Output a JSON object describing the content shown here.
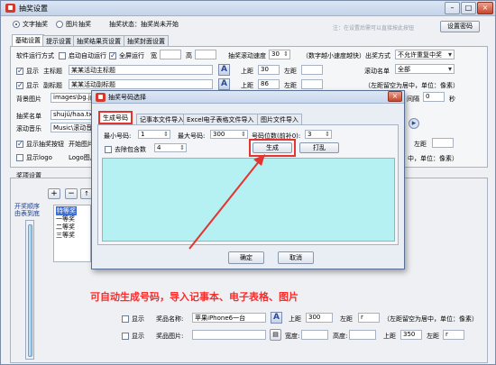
{
  "window": {
    "title": "抽奖设置",
    "minimize": "–",
    "maximize": "□",
    "close": "×"
  },
  "topbar": {
    "mode_text": "文字抽奖",
    "mode_image": "图片抽奖",
    "status": "抽奖状态：抽奖尚未开始",
    "note": "注：在设置后需可以直接按此按钮",
    "settings_pwd_button": "设置密码"
  },
  "tabs": [
    "基础设置",
    "提示设置",
    "抽奖结果页设置",
    "抽奖封面设置"
  ],
  "basic": {
    "run_mode_label": "软件运行方式",
    "auto_run": "启动自动运行",
    "fullscreen": "全屏运行",
    "width_label": "宽",
    "height_label": "高",
    "speed_label": "抽奖滚动速度",
    "speed_value": "30",
    "speed_note": "（数字越小速度越快）",
    "exit_mode_label": "出奖方式",
    "exit_mode_value": "不允许重复中奖",
    "show1": "显示",
    "main_title_label": "主标题",
    "main_title_value": "某某活动主标题",
    "show2": "显示",
    "sub_title_label": "副标题",
    "sub_title_value": "某某活动副标题",
    "top_label": "上距",
    "left_label": "左距",
    "main_top": "30",
    "sub_top": "86",
    "roll_list_label": "滚动名单",
    "roll_list_value": "全部",
    "center_note": "（左距留空为居中，单位：像素）",
    "bg_label": "背景图片",
    "bg_value": "images\\bg.jpg",
    "list_label": "抽奖名单",
    "list_value": "shujü/haa.txt",
    "music_label": "滚动音乐",
    "music_value": "Music\\滚动音乐",
    "interval_value": "0",
    "interval_unit": "秒",
    "show_button_label": "显示抽奖按钮",
    "start_text": "开始图片",
    "show_logo": "显示logo",
    "logo_text": "Logo图片",
    "right_center_note": "中，单位：像素）",
    "right_interval_label": "间隔"
  },
  "prize": {
    "group_label": "奖项设置",
    "add_btn": "+",
    "remove_btn": "−",
    "up_btn": "↑",
    "down_btn": "↓",
    "list": [
      "特等奖",
      "一等奖",
      "二等奖",
      "三等奖"
    ],
    "order_text": "开奖顺序由表到底",
    "show_a": "显示",
    "prize_name_label": "奖品名称:",
    "prize_name_value": "苹果iPhone6一台",
    "top_label": "上距",
    "top_value": "300",
    "left_label": "左距",
    "left_value": "r",
    "note": "（左距留空为居中，单位：像素）",
    "show_b": "显示",
    "prize_img_label": "奖品图片:",
    "width_label": "宽度:",
    "height_label": "高度:",
    "img_top": "350",
    "img_left": "r"
  },
  "dialog": {
    "title": "抽奖号码选择",
    "tabs": [
      "生成号码",
      "记事本文件导入",
      "Excel电子表格文件导入",
      "图片文件导入"
    ],
    "min_label": "最小号码:",
    "min_value": "1",
    "max_label": "最大号码:",
    "max_value": "300",
    "digits_label": "号码位数(前补0):",
    "digits_value": "3",
    "exclude_label": "去除包含数",
    "exclude_value": "4",
    "generate_button": "生成",
    "shuffle_button": "打乱",
    "ok_button": "确定",
    "cancel_button": "取消"
  },
  "caption": "可自动生成号码，导入记事本、电子表格、图片",
  "colors": {
    "caption": "#ff2a2a",
    "list_bg": "#b5f0f2",
    "arrow": "#e3342f"
  }
}
